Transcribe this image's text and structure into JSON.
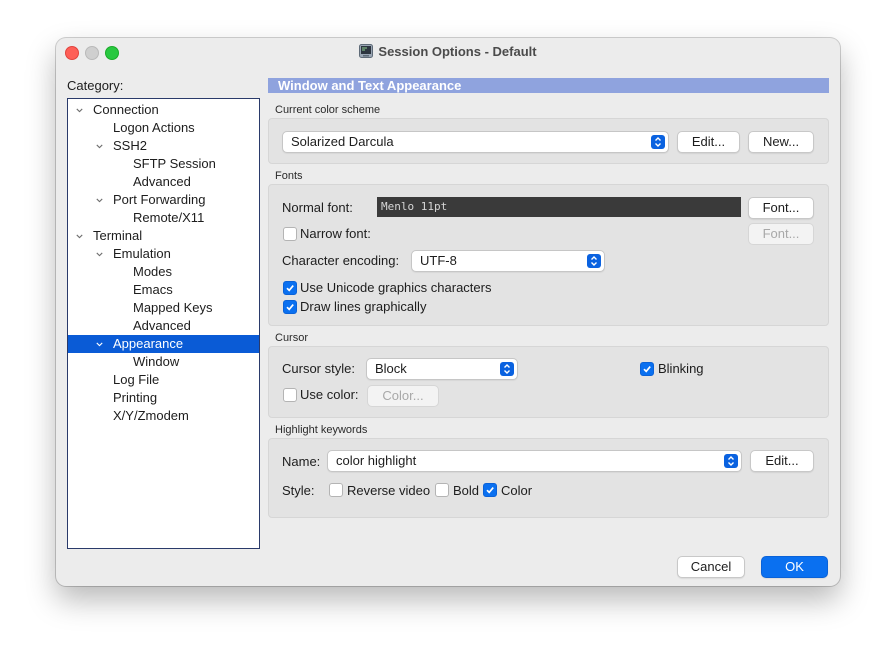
{
  "window": {
    "title": "Session Options - Default"
  },
  "category": {
    "label": "Category:",
    "tree": [
      {
        "label": "Connection",
        "level": 0,
        "expanded": true,
        "selected": false
      },
      {
        "label": "Logon Actions",
        "level": 1,
        "expanded": null,
        "selected": false
      },
      {
        "label": "SSH2",
        "level": 1,
        "expanded": true,
        "selected": false
      },
      {
        "label": "SFTP Session",
        "level": 2,
        "expanded": null,
        "selected": false
      },
      {
        "label": "Advanced",
        "level": 2,
        "expanded": null,
        "selected": false
      },
      {
        "label": "Port Forwarding",
        "level": 1,
        "expanded": true,
        "selected": false
      },
      {
        "label": "Remote/X11",
        "level": 2,
        "expanded": null,
        "selected": false
      },
      {
        "label": "Terminal",
        "level": 0,
        "expanded": true,
        "selected": false
      },
      {
        "label": "Emulation",
        "level": 1,
        "expanded": true,
        "selected": false
      },
      {
        "label": "Modes",
        "level": 2,
        "expanded": null,
        "selected": false
      },
      {
        "label": "Emacs",
        "level": 2,
        "expanded": null,
        "selected": false
      },
      {
        "label": "Mapped Keys",
        "level": 2,
        "expanded": null,
        "selected": false
      },
      {
        "label": "Advanced",
        "level": 2,
        "expanded": null,
        "selected": false
      },
      {
        "label": "Appearance",
        "level": 1,
        "expanded": true,
        "selected": true
      },
      {
        "label": "Window",
        "level": 2,
        "expanded": null,
        "selected": false
      },
      {
        "label": "Log File",
        "level": 1,
        "expanded": null,
        "selected": false
      },
      {
        "label": "Printing",
        "level": 1,
        "expanded": null,
        "selected": false
      },
      {
        "label": "X/Y/Zmodem",
        "level": 1,
        "expanded": null,
        "selected": false
      }
    ]
  },
  "panel": {
    "header": "Window and Text Appearance",
    "color_scheme": {
      "section": "Current color scheme",
      "value": "Solarized Darcula",
      "edit": "Edit...",
      "new": "New..."
    },
    "fonts": {
      "section": "Fonts",
      "normal_label": "Normal font:",
      "normal_value": "Menlo 11pt",
      "font_button": "Font...",
      "narrow_label": "Narrow font:",
      "narrow_checked": false,
      "narrow_button": "Font...",
      "encoding_label": "Character encoding:",
      "encoding_value": "UTF-8",
      "unicode_label": "Use Unicode graphics characters",
      "unicode_checked": true,
      "drawlines_label": "Draw lines graphically",
      "drawlines_checked": true
    },
    "cursor": {
      "section": "Cursor",
      "style_label": "Cursor style:",
      "style_value": "Block",
      "blinking_label": "Blinking",
      "blinking_checked": true,
      "usecolor_label": "Use color:",
      "usecolor_checked": false,
      "color_button": "Color..."
    },
    "highlight": {
      "section": "Highlight keywords",
      "name_label": "Name:",
      "name_value": "color highlight",
      "edit": "Edit...",
      "style_label": "Style:",
      "reverse_label": "Reverse video",
      "reverse_checked": false,
      "bold_label": "Bold",
      "bold_checked": false,
      "color_label": "Color",
      "color_checked": true
    }
  },
  "footer": {
    "cancel": "Cancel",
    "ok": "OK"
  },
  "colors": {
    "selection": "#0a5bd6",
    "header": "#8fa3de",
    "accent": "#0a70f0"
  }
}
